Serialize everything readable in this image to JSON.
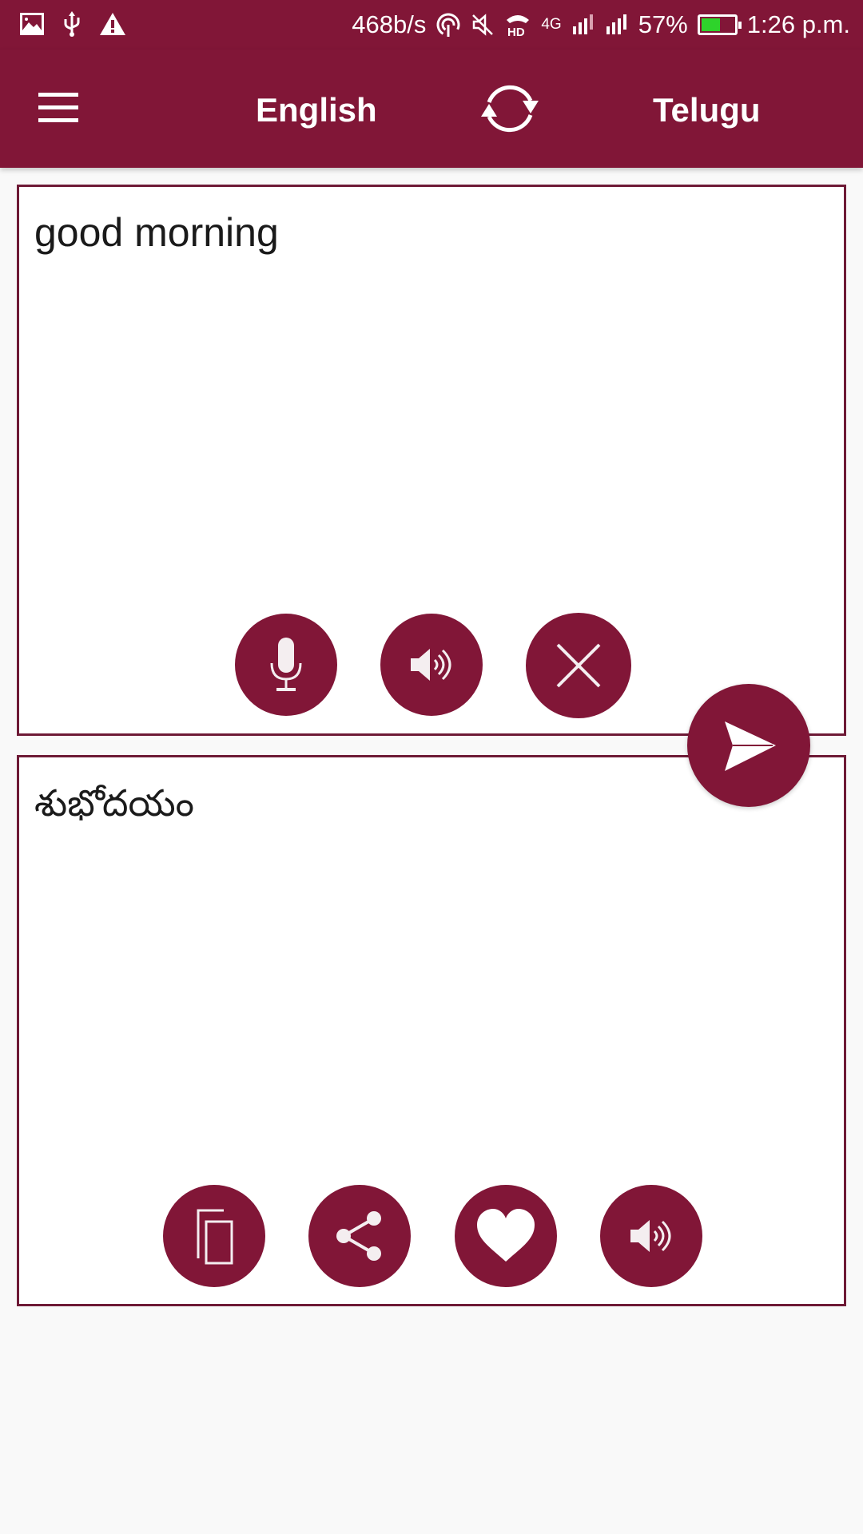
{
  "status_bar": {
    "left_icons": [
      "image-icon",
      "usb-icon",
      "warning-icon"
    ],
    "net_speed": "468b/s",
    "right_icons": [
      "hotspot-icon",
      "mute-icon",
      "hd-voice-icon",
      "signal-sim1-icon",
      "signal-sim2-icon"
    ],
    "network_type": "4G",
    "battery_percent": "57%",
    "battery_level": 0.57,
    "time": "1:26 p.m."
  },
  "app_bar": {
    "menu_icon": "hamburger-menu-icon",
    "source_language": "English",
    "swap_icon": "swap-languages-icon",
    "target_language": "Telugu"
  },
  "input_panel": {
    "text": "good morning",
    "buttons": [
      {
        "name": "microphone-button",
        "icon": "microphone-icon"
      },
      {
        "name": "speak-input-button",
        "icon": "speaker-icon"
      },
      {
        "name": "clear-button",
        "icon": "close-icon"
      }
    ]
  },
  "translate_button": {
    "icon": "send-icon"
  },
  "output_panel": {
    "text": "శుభోదయం",
    "buttons": [
      {
        "name": "copy-button",
        "icon": "copy-icon"
      },
      {
        "name": "share-button",
        "icon": "share-icon"
      },
      {
        "name": "favorite-button",
        "icon": "heart-icon"
      },
      {
        "name": "speak-output-button",
        "icon": "speaker-icon"
      }
    ]
  },
  "colors": {
    "primary": "#811637",
    "border": "#6e1a36",
    "background": "#f9f9f9",
    "battery_fill": "#2ed32b"
  }
}
